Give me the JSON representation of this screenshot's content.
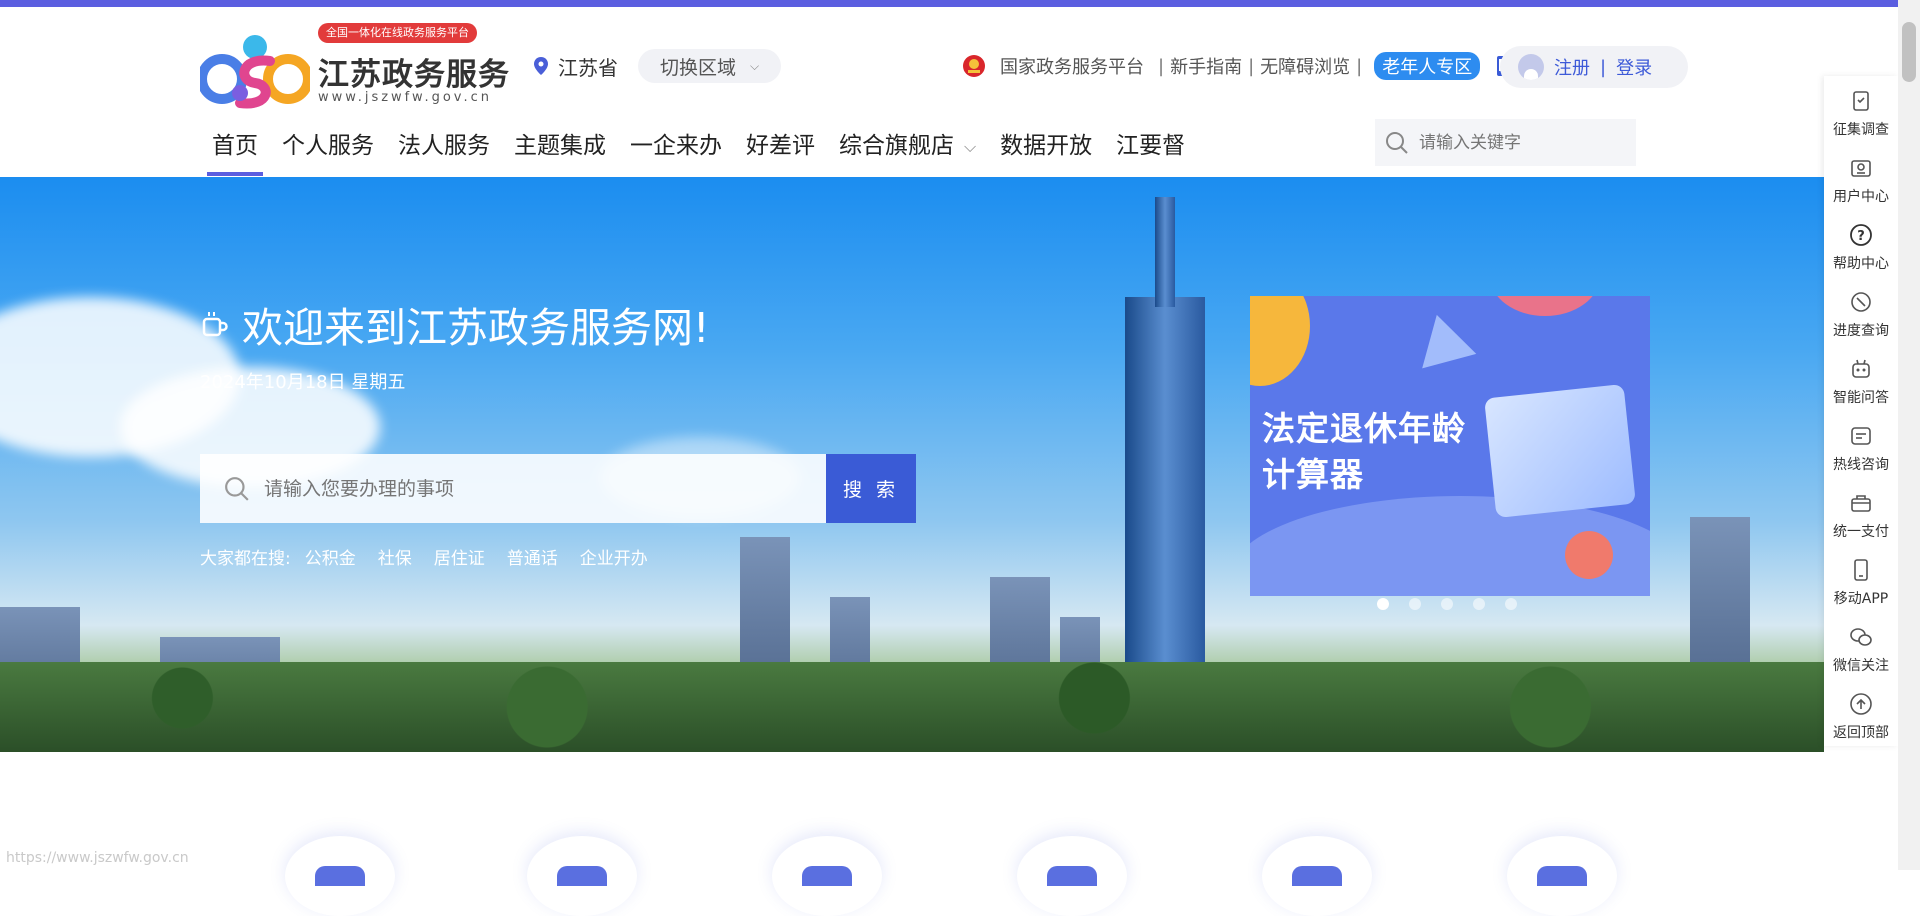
{
  "logo": {
    "badge": "全国一体化在线政务服务平台",
    "title": "江苏政务服务",
    "domain": "www.jszwfw.gov.cn"
  },
  "region": {
    "province": "江苏省",
    "switch_label": "切换区域"
  },
  "top_links": {
    "national": "国家政务服务平台",
    "guide": "新手指南",
    "accessible": "无障碍浏览",
    "elder": "老年人专区",
    "register": "注册",
    "login": "登录",
    "sep": "|"
  },
  "nav": {
    "items": [
      "首页",
      "个人服务",
      "法人服务",
      "主题集成",
      "一企来办",
      "好差评",
      "综合旗舰店",
      "数据开放",
      "江要督"
    ],
    "active_index": 0,
    "search_placeholder": "请输入关键字"
  },
  "hero": {
    "welcome": "欢迎来到江苏政务服务网!",
    "date": "2024年10月18日 星期五",
    "search_placeholder": "请输入您要办理的事项",
    "search_button": "搜 索",
    "hot_label": "大家都在搜:",
    "hot_terms": [
      "公积金",
      "社保",
      "居住证",
      "普通话",
      "企业开办"
    ]
  },
  "banner": {
    "text_line1": "法定退休年龄",
    "text_line2": "计算器",
    "slide_count": 5,
    "active_slide": 0
  },
  "sidebar": {
    "items": [
      {
        "label": "征集调查",
        "icon": "survey-icon"
      },
      {
        "label": "用户中心",
        "icon": "user-center-icon"
      },
      {
        "label": "帮助中心",
        "icon": "help-icon"
      },
      {
        "label": "进度查询",
        "icon": "progress-icon"
      },
      {
        "label": "智能问答",
        "icon": "robot-icon"
      },
      {
        "label": "热线咨询",
        "icon": "hotline-icon"
      },
      {
        "label": "统一支付",
        "icon": "payment-icon"
      },
      {
        "label": "移动APP",
        "icon": "mobile-app-icon"
      },
      {
        "label": "微信关注",
        "icon": "wechat-icon"
      },
      {
        "label": "返回顶部",
        "icon": "back-to-top-icon"
      }
    ]
  },
  "status_bar": {
    "url": "https://www.jszwfw.gov.cn"
  },
  "colors": {
    "accent": "#5b5ee0",
    "search_button": "#3a5bd6",
    "elder_badge": "#2d8cf0",
    "badge_red": "#e23b3b"
  }
}
